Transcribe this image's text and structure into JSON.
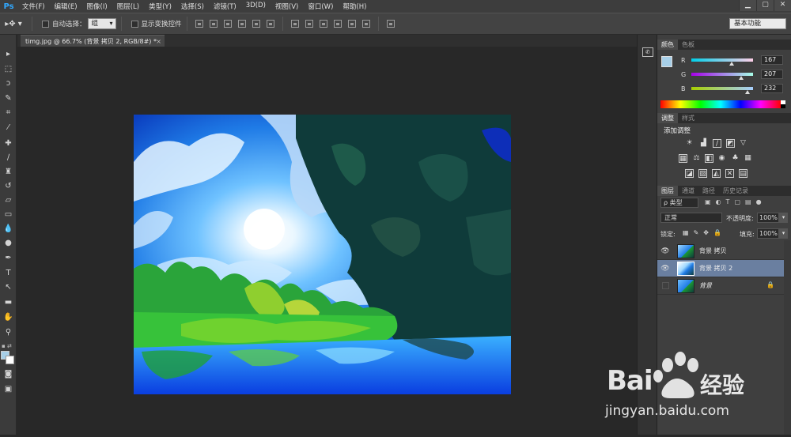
{
  "app": {
    "logo": "Ps"
  },
  "menu": [
    "文件(F)",
    "编辑(E)",
    "图像(I)",
    "图层(L)",
    "类型(Y)",
    "选择(S)",
    "滤镜(T)",
    "3D(D)",
    "视图(V)",
    "窗口(W)",
    "帮助(H)"
  ],
  "window_controls": [
    "▁",
    "▢",
    "✕"
  ],
  "options": {
    "auto_select_label": "自动选择：",
    "auto_select_value": "组",
    "show_transform_label": "显示变换控件",
    "workspace": "基本功能"
  },
  "document": {
    "tab_title": "timg.jpg @ 66.7% (背景 拷贝 2, RGB/8#) *",
    "close": "×"
  },
  "color_panel": {
    "tabs": [
      "颜色",
      "色板"
    ],
    "channels": [
      {
        "letter": "R",
        "value": "167",
        "fraction": 0.655
      },
      {
        "letter": "G",
        "value": "207",
        "fraction": 0.812
      },
      {
        "letter": "B",
        "value": "232",
        "fraction": 0.91
      }
    ],
    "fg_color": "#a7cfe8",
    "bg_color": "#ffffff"
  },
  "adjust_panel": {
    "tabs": [
      "调整",
      "样式"
    ],
    "title": "添加调整"
  },
  "layers_panel": {
    "tabs": [
      "图层",
      "通道",
      "路径",
      "历史记录"
    ],
    "filter_label": "ρ 类型",
    "blend_mode": "正常",
    "opacity_label": "不透明度:",
    "opacity_value": "100%",
    "lock_label": "锁定:",
    "fill_label": "填充:",
    "fill_value": "100%",
    "layers": [
      {
        "name": "背景 拷贝",
        "visible": true,
        "selected": false,
        "locked": false
      },
      {
        "name": "背景 拷贝 2",
        "visible": true,
        "selected": true,
        "locked": false
      },
      {
        "name": "背景",
        "visible": false,
        "selected": false,
        "locked": true
      }
    ]
  },
  "watermark": {
    "brand": "Bai",
    "brand2": "经验",
    "url": "jingyan.baidu.com"
  },
  "colors": {
    "accent": "#31a8ff",
    "selected_layer": "#6a7fa0"
  }
}
